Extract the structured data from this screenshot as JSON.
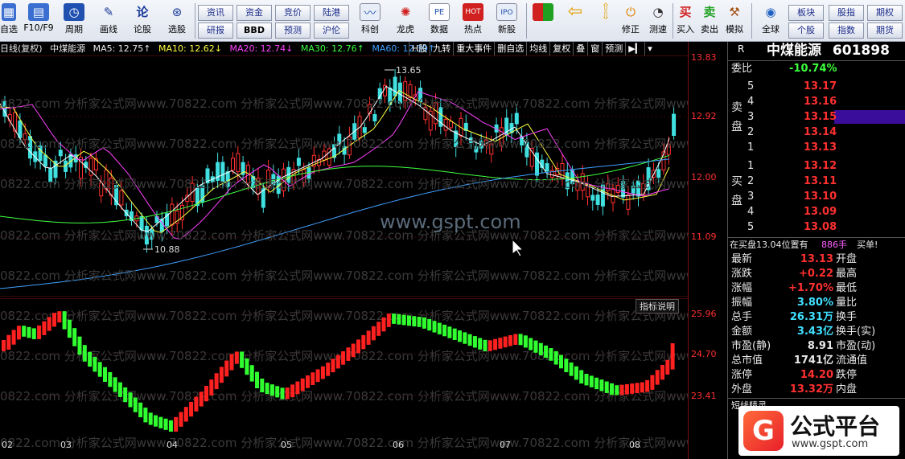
{
  "toolbar": {
    "left_items": [
      {
        "label": "自选",
        "icon": "grid-icon"
      },
      {
        "label": "F10/F9",
        "icon": "f10-icon"
      },
      {
        "label": "周期",
        "icon": "clock-icon"
      },
      {
        "label": "画线",
        "icon": "pen-icon"
      },
      {
        "label": "论股",
        "icon": "discuss-icon"
      },
      {
        "label": "选股",
        "icon": "select-stock-icon"
      }
    ],
    "small_buttons_row1": [
      "资讯",
      "资金",
      "竞价",
      "陆港"
    ],
    "small_buttons_row2": [
      "研报",
      "BBD",
      "预测",
      "沪伦"
    ],
    "mid_items": [
      {
        "label": "科创",
        "icon": "kechuang-icon"
      },
      {
        "label": "龙虎",
        "icon": "dragon-tiger-icon"
      },
      {
        "label": "数据",
        "icon": "data-icon"
      },
      {
        "label": "热点",
        "icon": "hot-icon"
      },
      {
        "label": "新股",
        "icon": "ipo-icon"
      }
    ],
    "right_items": [
      {
        "label": "修正",
        "icon": "revise-icon"
      },
      {
        "label": "测速",
        "icon": "speed-test-icon"
      },
      {
        "label": "买入",
        "icon": "buy-icon",
        "glyph": "买"
      },
      {
        "label": "卖出",
        "icon": "sell-icon",
        "glyph": "卖"
      },
      {
        "label": "模拟",
        "icon": "simulate-icon"
      },
      {
        "label": "全球",
        "icon": "globe-icon"
      }
    ],
    "market_buttons_row1": [
      "板块",
      "股指",
      "期权"
    ],
    "market_buttons_row2": [
      "个股",
      "指数",
      "期货"
    ]
  },
  "chart_header": {
    "period": "日线(复权)",
    "name": "中煤能源",
    "ma5": "MA5: 12.75↑",
    "ma10": "MA10: 12.62↓",
    "ma20": "MA20: 12.74↓",
    "ma30": "MA30: 12.76↑",
    "ma60": "MA60: 12.39↑",
    "buttons": [
      "H股",
      "九转",
      "重大事件",
      "删自选",
      "均线",
      "复权",
      "叠",
      "窗",
      "预测"
    ]
  },
  "watermarks": {
    "repeat_text": "0822.com 分析家公式网www.70822.com 分析家公式网www.70822.com 分析家公式网www.70822.com 分析家公式网www.70822.com",
    "center_text": "www.gspt.com"
  },
  "sub_chart_label": "指标说明",
  "price_scale": [
    "13.83",
    "12.92",
    "12.00",
    "11.09"
  ],
  "sub_scale": [
    "25.96",
    "24.70",
    "23.41"
  ],
  "month_labels": [
    "02",
    "03",
    "04",
    "05",
    "06",
    "07",
    "08"
  ],
  "annotations": {
    "high": "13.65",
    "low": "10.88"
  },
  "stock": {
    "name": "中煤能源",
    "code": "601898"
  },
  "order_book": {
    "weibi_label": "委比",
    "weibi": "-10.74%",
    "sell_label": "卖盘",
    "buy_label": "买盘",
    "sells": [
      {
        "level": "5",
        "price": "13.17"
      },
      {
        "level": "4",
        "price": "13.16"
      },
      {
        "level": "3",
        "price": "13.15"
      },
      {
        "level": "2",
        "price": "13.14"
      },
      {
        "level": "1",
        "price": "13.13"
      }
    ],
    "buys": [
      {
        "level": "1",
        "price": "13.12"
      },
      {
        "level": "2",
        "price": "13.11"
      },
      {
        "level": "3",
        "price": "13.10"
      },
      {
        "level": "4",
        "price": "13.09"
      },
      {
        "level": "5",
        "price": "13.08"
      }
    ]
  },
  "trade_notice": {
    "text": "在买盘13.04位置有",
    "qty": "886手",
    "action": "买单!"
  },
  "quote_rows": [
    {
      "l1": "最新",
      "v1": "13.13",
      "l2": "开盘",
      "c1": "red"
    },
    {
      "l1": "涨跌",
      "v1": "+0.22",
      "l2": "最高",
      "c1": "red"
    },
    {
      "l1": "涨幅",
      "v1": "+1.70%",
      "l2": "最低",
      "c1": "red"
    },
    {
      "l1": "振幅",
      "v1": "3.80%",
      "l2": "量比",
      "c1": "cya"
    },
    {
      "l1": "总手",
      "v1": "26.31万",
      "l2": "换手",
      "c1": "cya"
    },
    {
      "l1": "金额",
      "v1": "3.43亿",
      "l2": "换手(实)",
      "c1": "cya"
    },
    {
      "l1": "市盈(静)",
      "v1": "8.91",
      "l2": "市盈(动)",
      "c1": "wht"
    },
    {
      "l1": "总市值",
      "v1": "1741亿",
      "l2": "流通值",
      "c1": "wht"
    },
    {
      "l1": "涨停",
      "v1": "14.20",
      "l2": "跌停",
      "c1": "red"
    },
    {
      "l1": "外盘",
      "v1": "13.32万",
      "l2": "内盘",
      "c1": "red"
    }
  ],
  "bottom_tab": "短线精灵",
  "brand": {
    "name": "公式平台",
    "url": "www.gspt.com"
  },
  "colors": {
    "up": "#ff3030",
    "down": "#40e0e0",
    "ma5": "#ffffff",
    "ma10": "#ffff40",
    "ma20": "#ff40ff",
    "ma30": "#40ff40",
    "ma60": "#40a0ff",
    "sub_up": "#ff2020",
    "sub_down": "#30ff30"
  }
}
